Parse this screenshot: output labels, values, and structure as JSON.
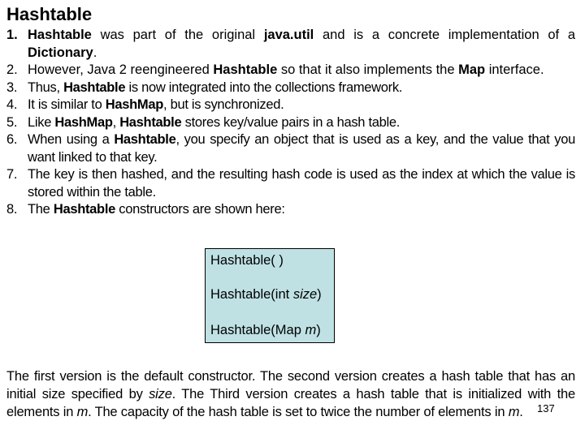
{
  "title": "Hashtable",
  "items": [
    {
      "num": "1.",
      "parts": [
        {
          "t": "Hashtable",
          "b": true
        },
        {
          "t": " was part of the original "
        },
        {
          "t": "java.util",
          "b": true
        },
        {
          "t": " and is a concrete implementation of a "
        },
        {
          "t": "Dictionary",
          "b": true
        },
        {
          "t": "."
        }
      ]
    },
    {
      "num": "2.",
      "parts": [
        {
          "t": "However, Java 2 reengineered "
        },
        {
          "t": "Hashtable",
          "b": true
        },
        {
          "t": " so that it also implements the "
        },
        {
          "t": "Map",
          "b": true
        },
        {
          "t": " interface."
        }
      ]
    },
    {
      "num": "3.",
      "parts": [
        {
          "t": "Thus, "
        },
        {
          "t": "Hashtable",
          "b": true
        },
        {
          "t": " is now integrated into the collections framework."
        }
      ]
    },
    {
      "num": "4.",
      "parts": [
        {
          "t": "It is similar to "
        },
        {
          "t": "HashMap",
          "b": true
        },
        {
          "t": ", but is synchronized."
        }
      ]
    },
    {
      "num": "5.",
      "parts": [
        {
          "t": "Like "
        },
        {
          "t": "HashMap",
          "b": true
        },
        {
          "t": ", "
        },
        {
          "t": "Hashtable",
          "b": true
        },
        {
          "t": " stores key/value pairs in a hash table."
        }
      ]
    },
    {
      "num": "6.",
      "parts": [
        {
          "t": "When using a "
        },
        {
          "t": "Hashtable",
          "b": true
        },
        {
          "t": ", you specify an object that is used as a key, and the value that you want linked to that key."
        }
      ]
    },
    {
      "num": "7.",
      "parts": [
        {
          "t": "The key is then hashed, and the resulting hash code is used as the index at which the value is stored within the table."
        }
      ]
    },
    {
      "num": "8.",
      "parts": [
        {
          "t": "The "
        },
        {
          "t": "Hashtable",
          "b": true
        },
        {
          "t": " constructors are shown here:"
        }
      ]
    }
  ],
  "constructors": [
    [
      {
        "t": "Hashtable( )"
      }
    ],
    [
      {
        "t": "Hashtable(int "
      },
      {
        "t": "size",
        "i": true
      },
      {
        "t": ")"
      }
    ],
    [
      {
        "t": "Hashtable(Map "
      },
      {
        "t": "m",
        "i": true
      },
      {
        "t": ")"
      }
    ]
  ],
  "paragraph": [
    {
      "t": "The first version is the default constructor. The second version creates a hash table that has an initial size specified by "
    },
    {
      "t": "size",
      "i": true
    },
    {
      "t": ". The Third version creates a hash table that is initialized with the elements in "
    },
    {
      "t": "m",
      "i": true
    },
    {
      "t": ". The capacity of the hash table is set to twice the number of elements in "
    },
    {
      "t": "m",
      "i": true
    },
    {
      "t": "."
    }
  ],
  "colors": {
    "box_background": "#bfe1e4",
    "box_border": "#000000"
  },
  "page_number": "137"
}
